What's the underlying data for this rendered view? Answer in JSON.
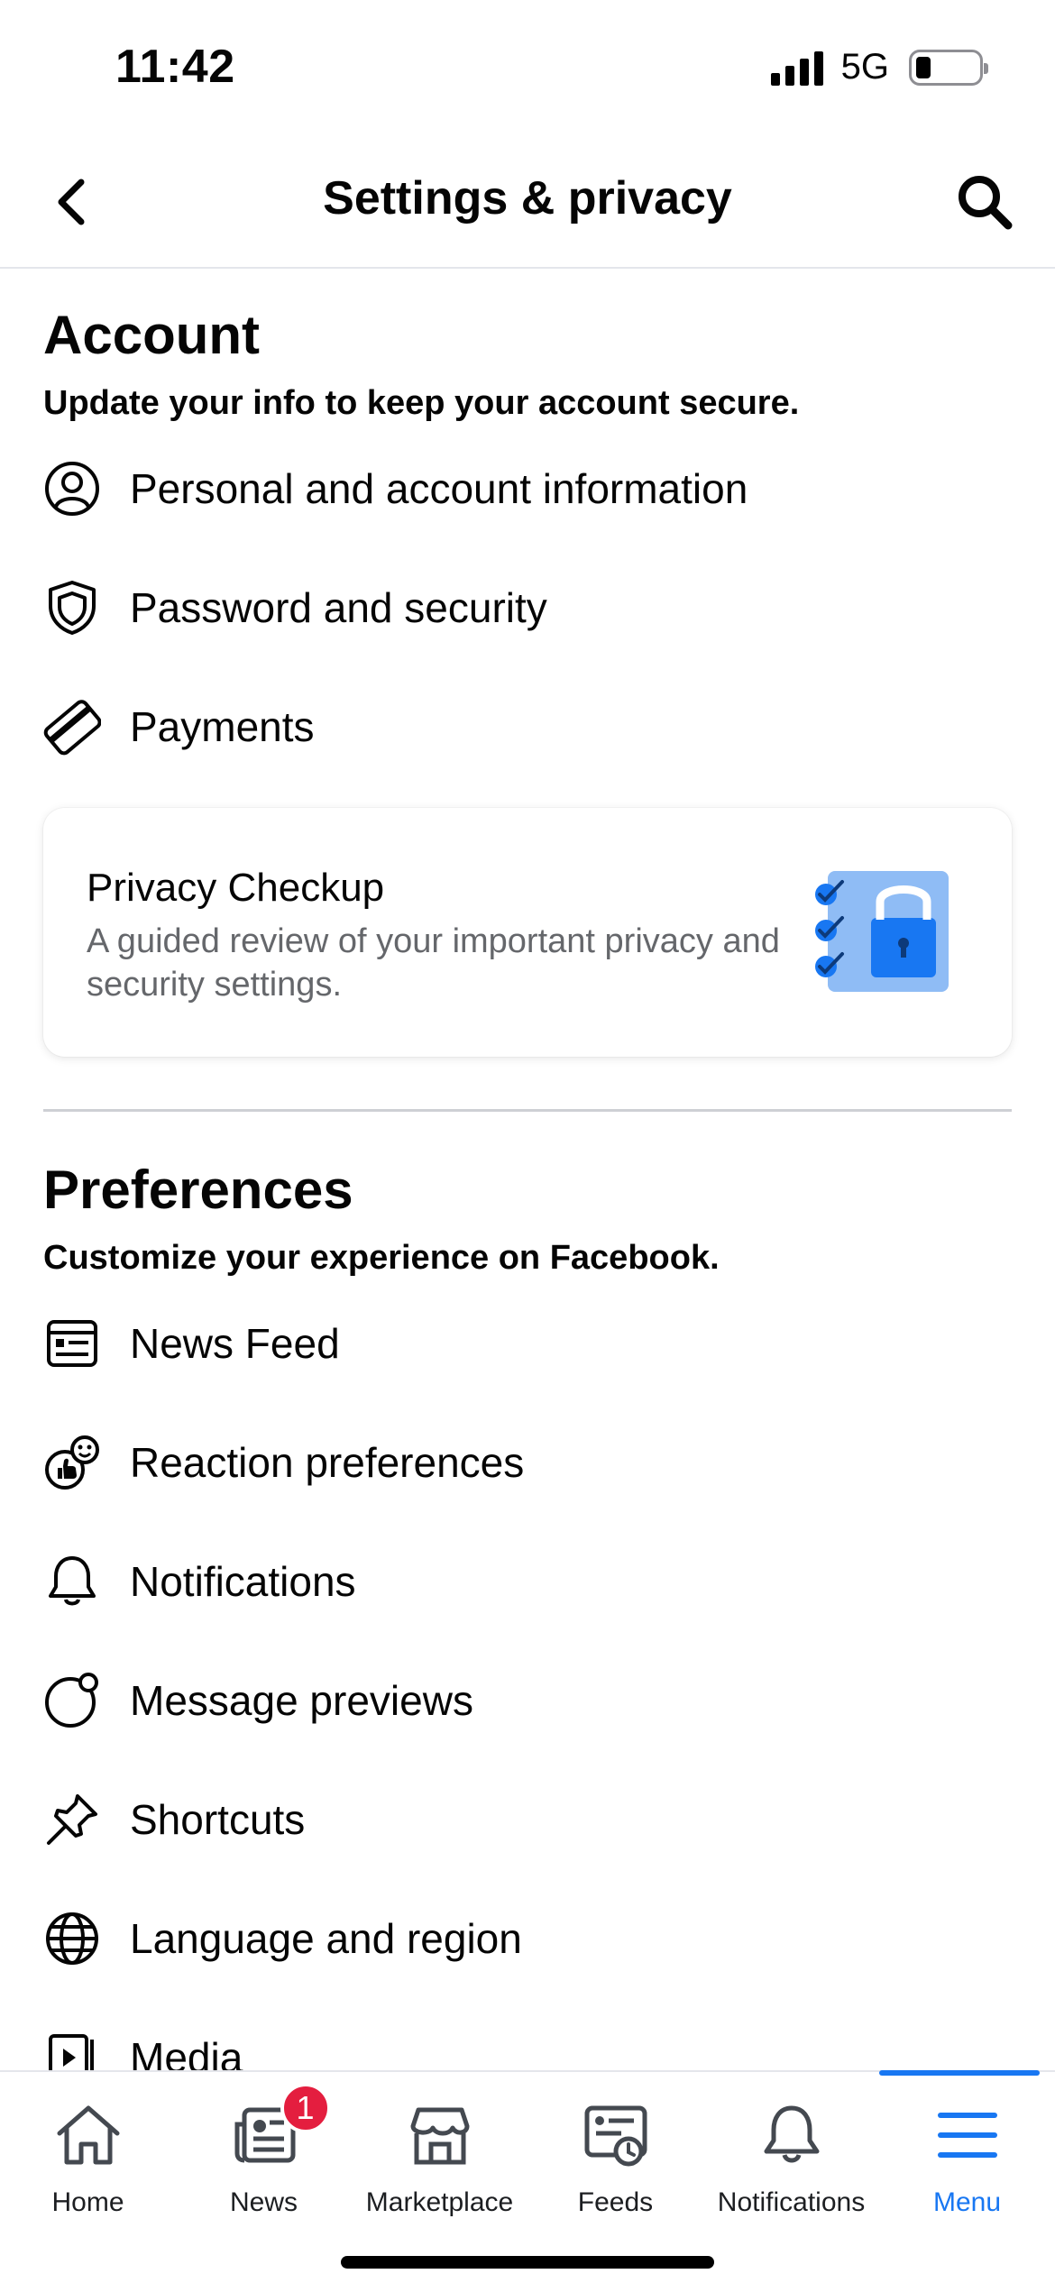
{
  "status_bar": {
    "time": "11:42",
    "network": "5G"
  },
  "header": {
    "title": "Settings & privacy"
  },
  "account": {
    "heading": "Account",
    "subtitle": "Update your info to keep your account secure.",
    "items": [
      {
        "label": "Personal and account information",
        "icon": "person-circle-icon"
      },
      {
        "label": "Password and security",
        "icon": "shield-icon"
      },
      {
        "label": "Payments",
        "icon": "credit-card-icon"
      }
    ]
  },
  "privacy_card": {
    "title": "Privacy Checkup",
    "description": "A guided review of your important privacy and security settings.",
    "art": "privacy-checkup-lock-illustration"
  },
  "preferences": {
    "heading": "Preferences",
    "subtitle": "Customize your experience on Facebook.",
    "items": [
      {
        "label": "News Feed",
        "icon": "news-feed-icon"
      },
      {
        "label": "Reaction preferences",
        "icon": "reaction-icon"
      },
      {
        "label": "Notifications",
        "icon": "bell-icon"
      },
      {
        "label": "Message previews",
        "icon": "message-preview-icon"
      },
      {
        "label": "Shortcuts",
        "icon": "pin-icon"
      },
      {
        "label": "Language and region",
        "icon": "globe-icon"
      },
      {
        "label": "Media",
        "icon": "media-icon"
      }
    ]
  },
  "tabbar": {
    "items": [
      {
        "label": "Home",
        "icon": "home-icon"
      },
      {
        "label": "News",
        "icon": "news-icon",
        "badge": "1"
      },
      {
        "label": "Marketplace",
        "icon": "marketplace-icon"
      },
      {
        "label": "Feeds",
        "icon": "feeds-icon"
      },
      {
        "label": "Notifications",
        "icon": "bell-icon"
      },
      {
        "label": "Menu",
        "icon": "menu-icon",
        "active": true
      }
    ]
  },
  "colors": {
    "accent": "#1877f2",
    "badge": "#e41e3f",
    "secondary_text": "#65676b"
  }
}
